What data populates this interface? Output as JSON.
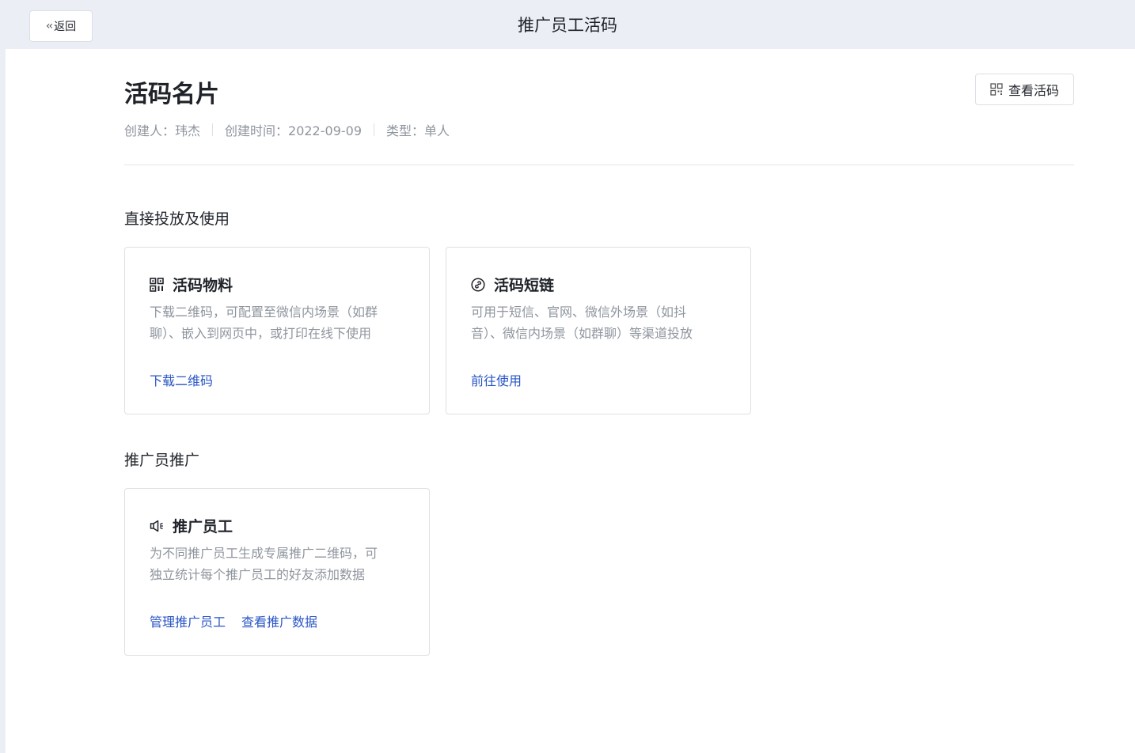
{
  "header": {
    "back_label": "返回",
    "title": "推广员工活码"
  },
  "profile": {
    "title": "活码名片",
    "creator": "创建人：玮杰",
    "created_time": "创建时间：2022-09-09",
    "type": "类型：单人",
    "view_button": "查看活码"
  },
  "sections": {
    "direct": {
      "title": "直接投放及使用",
      "cards": [
        {
          "icon": "qrcode-icon",
          "title": "活码物料",
          "desc_line1": "下载二维码，可配置至微信内场景（如群",
          "desc_line2": "聊）、嵌入到网页中，或打印在线下使用",
          "link": "下载二维码"
        },
        {
          "icon": "link-icon",
          "title": "活码短链",
          "desc_line1": "可用于短信、官网、微信外场景（如抖",
          "desc_line2": "音）、微信内场景（如群聊）等渠道投放",
          "link": "前往使用"
        }
      ]
    },
    "promoter": {
      "title": "推广员推广",
      "card": {
        "icon": "megaphone-icon",
        "title": "推广员工",
        "desc_line1": "为不同推广员工生成专属推广二维码，可",
        "desc_line2": "独立统计每个推广员工的好友添加数据",
        "link1": "管理推广员工",
        "link2": "查看推广数据"
      }
    }
  }
}
